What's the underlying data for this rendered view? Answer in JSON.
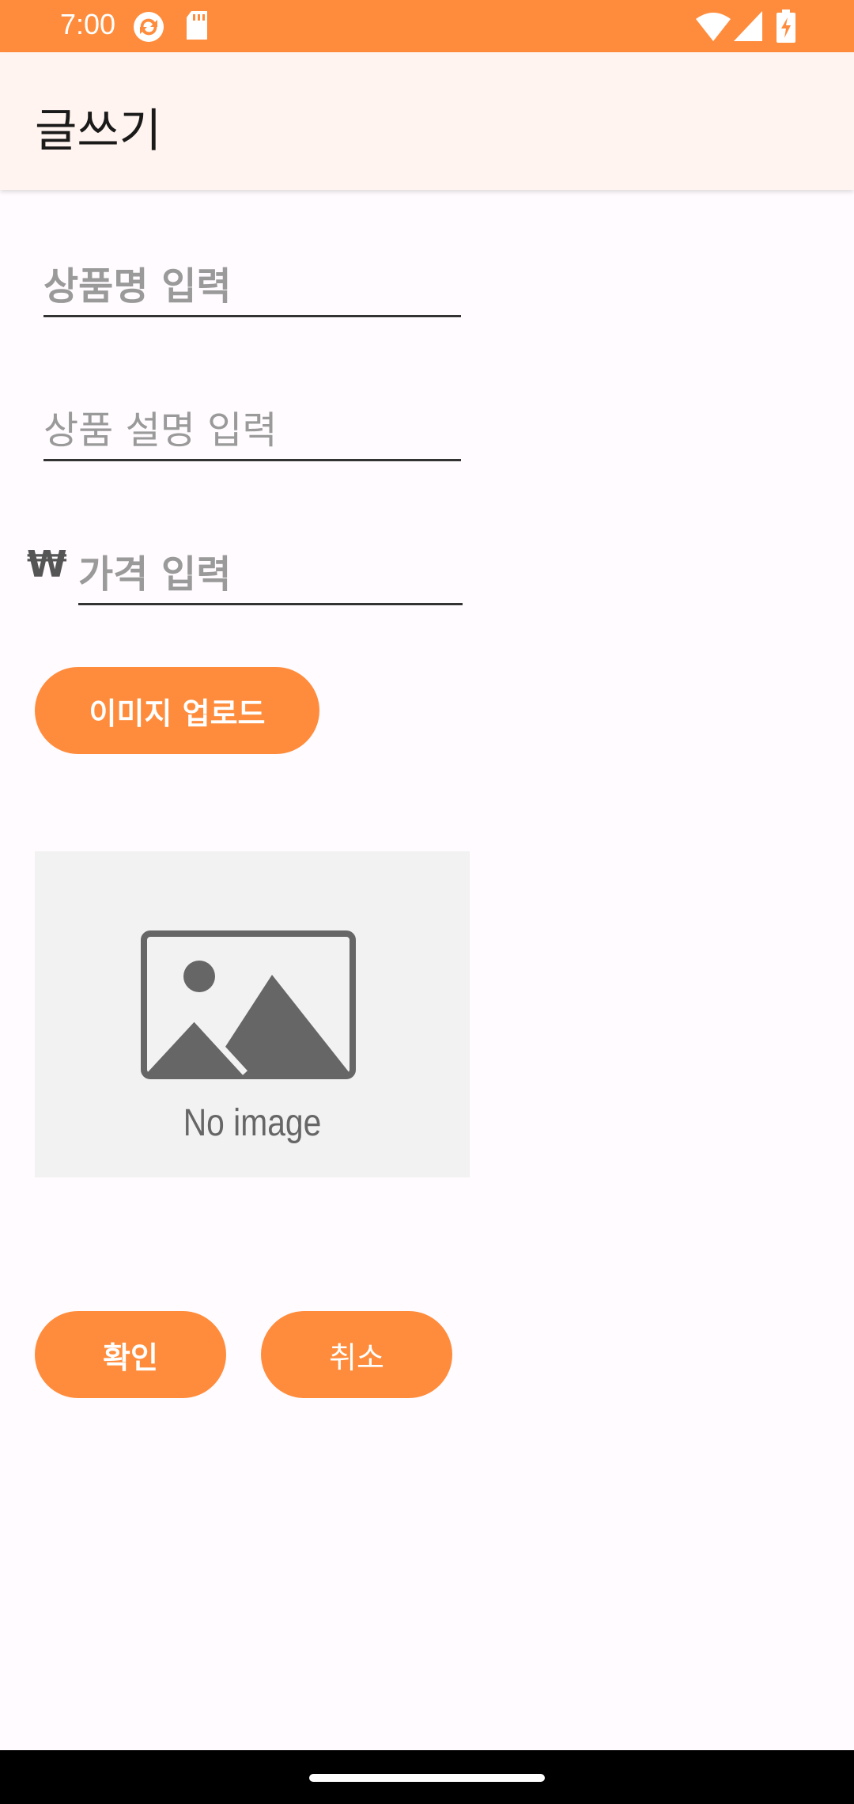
{
  "status_bar": {
    "time": "7:00",
    "icons_left": [
      "sync-icon",
      "sd-card-icon"
    ],
    "icons_right": [
      "wifi-icon",
      "signal-icon",
      "battery-icon"
    ],
    "color": "#ff8c3c"
  },
  "app_bar": {
    "title": "글쓰기"
  },
  "form": {
    "name_placeholder": "상품명 입력",
    "description_placeholder": "상품 설명 입력",
    "price_placeholder": "가격 입력",
    "currency_symbol": "₩"
  },
  "upload_button": {
    "label": "이미지 업로드"
  },
  "image_preview": {
    "text": "No image"
  },
  "actions": {
    "confirm_label": "확인",
    "cancel_label": "취소"
  },
  "colors": {
    "accent": "#ff8c3c",
    "app_bar_bg": "#fff4ef",
    "page_bg": "#fffbfe"
  }
}
